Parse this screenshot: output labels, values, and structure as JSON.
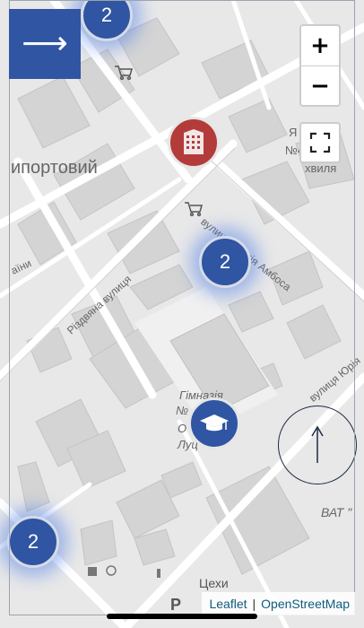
{
  "panel_toggle": {
    "arrow": "⟶"
  },
  "zoom": {
    "in_label": "+",
    "out_label": "−"
  },
  "clusters": [
    {
      "count": "2"
    },
    {
      "count": "2"
    },
    {
      "count": "2"
    }
  ],
  "markers": [
    {
      "type": "bank-building"
    },
    {
      "type": "school-graduation-cap"
    }
  ],
  "map_labels": {
    "district": "ипортовий",
    "street_ambrosa": "вулиця Сергія Амбоса",
    "street_rizdvyana": "Різдвяна вулиця",
    "street_yuriya": "вулиця Юрія",
    "street_partial": "аїни",
    "school_line1": "Гімназія",
    "school_line2": "№",
    "school_line3": "О",
    "school_line4": "Луц",
    "poi_top_right_1": "Я",
    "poi_top_right_2": "№4",
    "poi_top_right_3": "хвиля",
    "pvat": "ВАТ \"",
    "tsekhy": "Цехи",
    "parking": "P"
  },
  "attribution": {
    "leaflet": "Leaflet",
    "osm": "OpenStreetMap",
    "separator": "|"
  },
  "colors": {
    "accent": "#2f55a3",
    "bank": "#b33b3a",
    "map_bg": "#e6e6e6"
  }
}
